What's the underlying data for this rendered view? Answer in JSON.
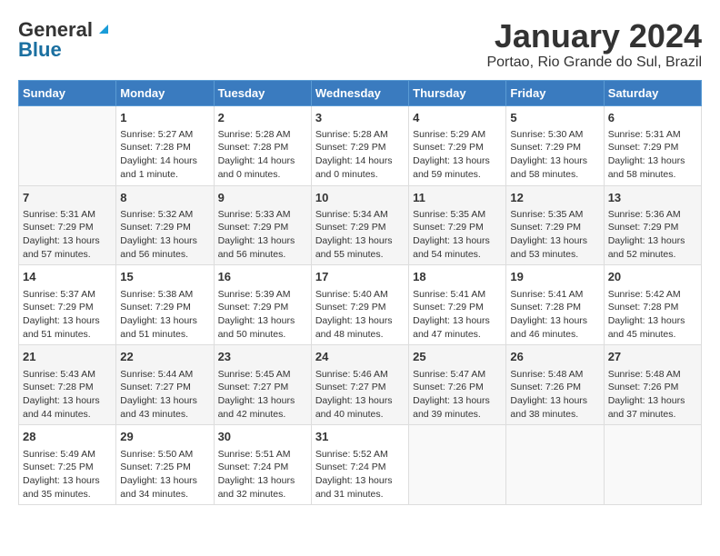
{
  "header": {
    "logo_general": "General",
    "logo_blue": "Blue",
    "title": "January 2024",
    "location": "Portao, Rio Grande do Sul, Brazil"
  },
  "calendar": {
    "days_of_week": [
      "Sunday",
      "Monday",
      "Tuesday",
      "Wednesday",
      "Thursday",
      "Friday",
      "Saturday"
    ],
    "weeks": [
      [
        {
          "day": "",
          "content": ""
        },
        {
          "day": "1",
          "content": "Sunrise: 5:27 AM\nSunset: 7:28 PM\nDaylight: 14 hours\nand 1 minute."
        },
        {
          "day": "2",
          "content": "Sunrise: 5:28 AM\nSunset: 7:28 PM\nDaylight: 14 hours\nand 0 minutes."
        },
        {
          "day": "3",
          "content": "Sunrise: 5:28 AM\nSunset: 7:29 PM\nDaylight: 14 hours\nand 0 minutes."
        },
        {
          "day": "4",
          "content": "Sunrise: 5:29 AM\nSunset: 7:29 PM\nDaylight: 13 hours\nand 59 minutes."
        },
        {
          "day": "5",
          "content": "Sunrise: 5:30 AM\nSunset: 7:29 PM\nDaylight: 13 hours\nand 58 minutes."
        },
        {
          "day": "6",
          "content": "Sunrise: 5:31 AM\nSunset: 7:29 PM\nDaylight: 13 hours\nand 58 minutes."
        }
      ],
      [
        {
          "day": "7",
          "content": "Sunrise: 5:31 AM\nSunset: 7:29 PM\nDaylight: 13 hours\nand 57 minutes."
        },
        {
          "day": "8",
          "content": "Sunrise: 5:32 AM\nSunset: 7:29 PM\nDaylight: 13 hours\nand 56 minutes."
        },
        {
          "day": "9",
          "content": "Sunrise: 5:33 AM\nSunset: 7:29 PM\nDaylight: 13 hours\nand 56 minutes."
        },
        {
          "day": "10",
          "content": "Sunrise: 5:34 AM\nSunset: 7:29 PM\nDaylight: 13 hours\nand 55 minutes."
        },
        {
          "day": "11",
          "content": "Sunrise: 5:35 AM\nSunset: 7:29 PM\nDaylight: 13 hours\nand 54 minutes."
        },
        {
          "day": "12",
          "content": "Sunrise: 5:35 AM\nSunset: 7:29 PM\nDaylight: 13 hours\nand 53 minutes."
        },
        {
          "day": "13",
          "content": "Sunrise: 5:36 AM\nSunset: 7:29 PM\nDaylight: 13 hours\nand 52 minutes."
        }
      ],
      [
        {
          "day": "14",
          "content": "Sunrise: 5:37 AM\nSunset: 7:29 PM\nDaylight: 13 hours\nand 51 minutes."
        },
        {
          "day": "15",
          "content": "Sunrise: 5:38 AM\nSunset: 7:29 PM\nDaylight: 13 hours\nand 51 minutes."
        },
        {
          "day": "16",
          "content": "Sunrise: 5:39 AM\nSunset: 7:29 PM\nDaylight: 13 hours\nand 50 minutes."
        },
        {
          "day": "17",
          "content": "Sunrise: 5:40 AM\nSunset: 7:29 PM\nDaylight: 13 hours\nand 48 minutes."
        },
        {
          "day": "18",
          "content": "Sunrise: 5:41 AM\nSunset: 7:29 PM\nDaylight: 13 hours\nand 47 minutes."
        },
        {
          "day": "19",
          "content": "Sunrise: 5:41 AM\nSunset: 7:28 PM\nDaylight: 13 hours\nand 46 minutes."
        },
        {
          "day": "20",
          "content": "Sunrise: 5:42 AM\nSunset: 7:28 PM\nDaylight: 13 hours\nand 45 minutes."
        }
      ],
      [
        {
          "day": "21",
          "content": "Sunrise: 5:43 AM\nSunset: 7:28 PM\nDaylight: 13 hours\nand 44 minutes."
        },
        {
          "day": "22",
          "content": "Sunrise: 5:44 AM\nSunset: 7:27 PM\nDaylight: 13 hours\nand 43 minutes."
        },
        {
          "day": "23",
          "content": "Sunrise: 5:45 AM\nSunset: 7:27 PM\nDaylight: 13 hours\nand 42 minutes."
        },
        {
          "day": "24",
          "content": "Sunrise: 5:46 AM\nSunset: 7:27 PM\nDaylight: 13 hours\nand 40 minutes."
        },
        {
          "day": "25",
          "content": "Sunrise: 5:47 AM\nSunset: 7:26 PM\nDaylight: 13 hours\nand 39 minutes."
        },
        {
          "day": "26",
          "content": "Sunrise: 5:48 AM\nSunset: 7:26 PM\nDaylight: 13 hours\nand 38 minutes."
        },
        {
          "day": "27",
          "content": "Sunrise: 5:48 AM\nSunset: 7:26 PM\nDaylight: 13 hours\nand 37 minutes."
        }
      ],
      [
        {
          "day": "28",
          "content": "Sunrise: 5:49 AM\nSunset: 7:25 PM\nDaylight: 13 hours\nand 35 minutes."
        },
        {
          "day": "29",
          "content": "Sunrise: 5:50 AM\nSunset: 7:25 PM\nDaylight: 13 hours\nand 34 minutes."
        },
        {
          "day": "30",
          "content": "Sunrise: 5:51 AM\nSunset: 7:24 PM\nDaylight: 13 hours\nand 32 minutes."
        },
        {
          "day": "31",
          "content": "Sunrise: 5:52 AM\nSunset: 7:24 PM\nDaylight: 13 hours\nand 31 minutes."
        },
        {
          "day": "",
          "content": ""
        },
        {
          "day": "",
          "content": ""
        },
        {
          "day": "",
          "content": ""
        }
      ]
    ]
  }
}
